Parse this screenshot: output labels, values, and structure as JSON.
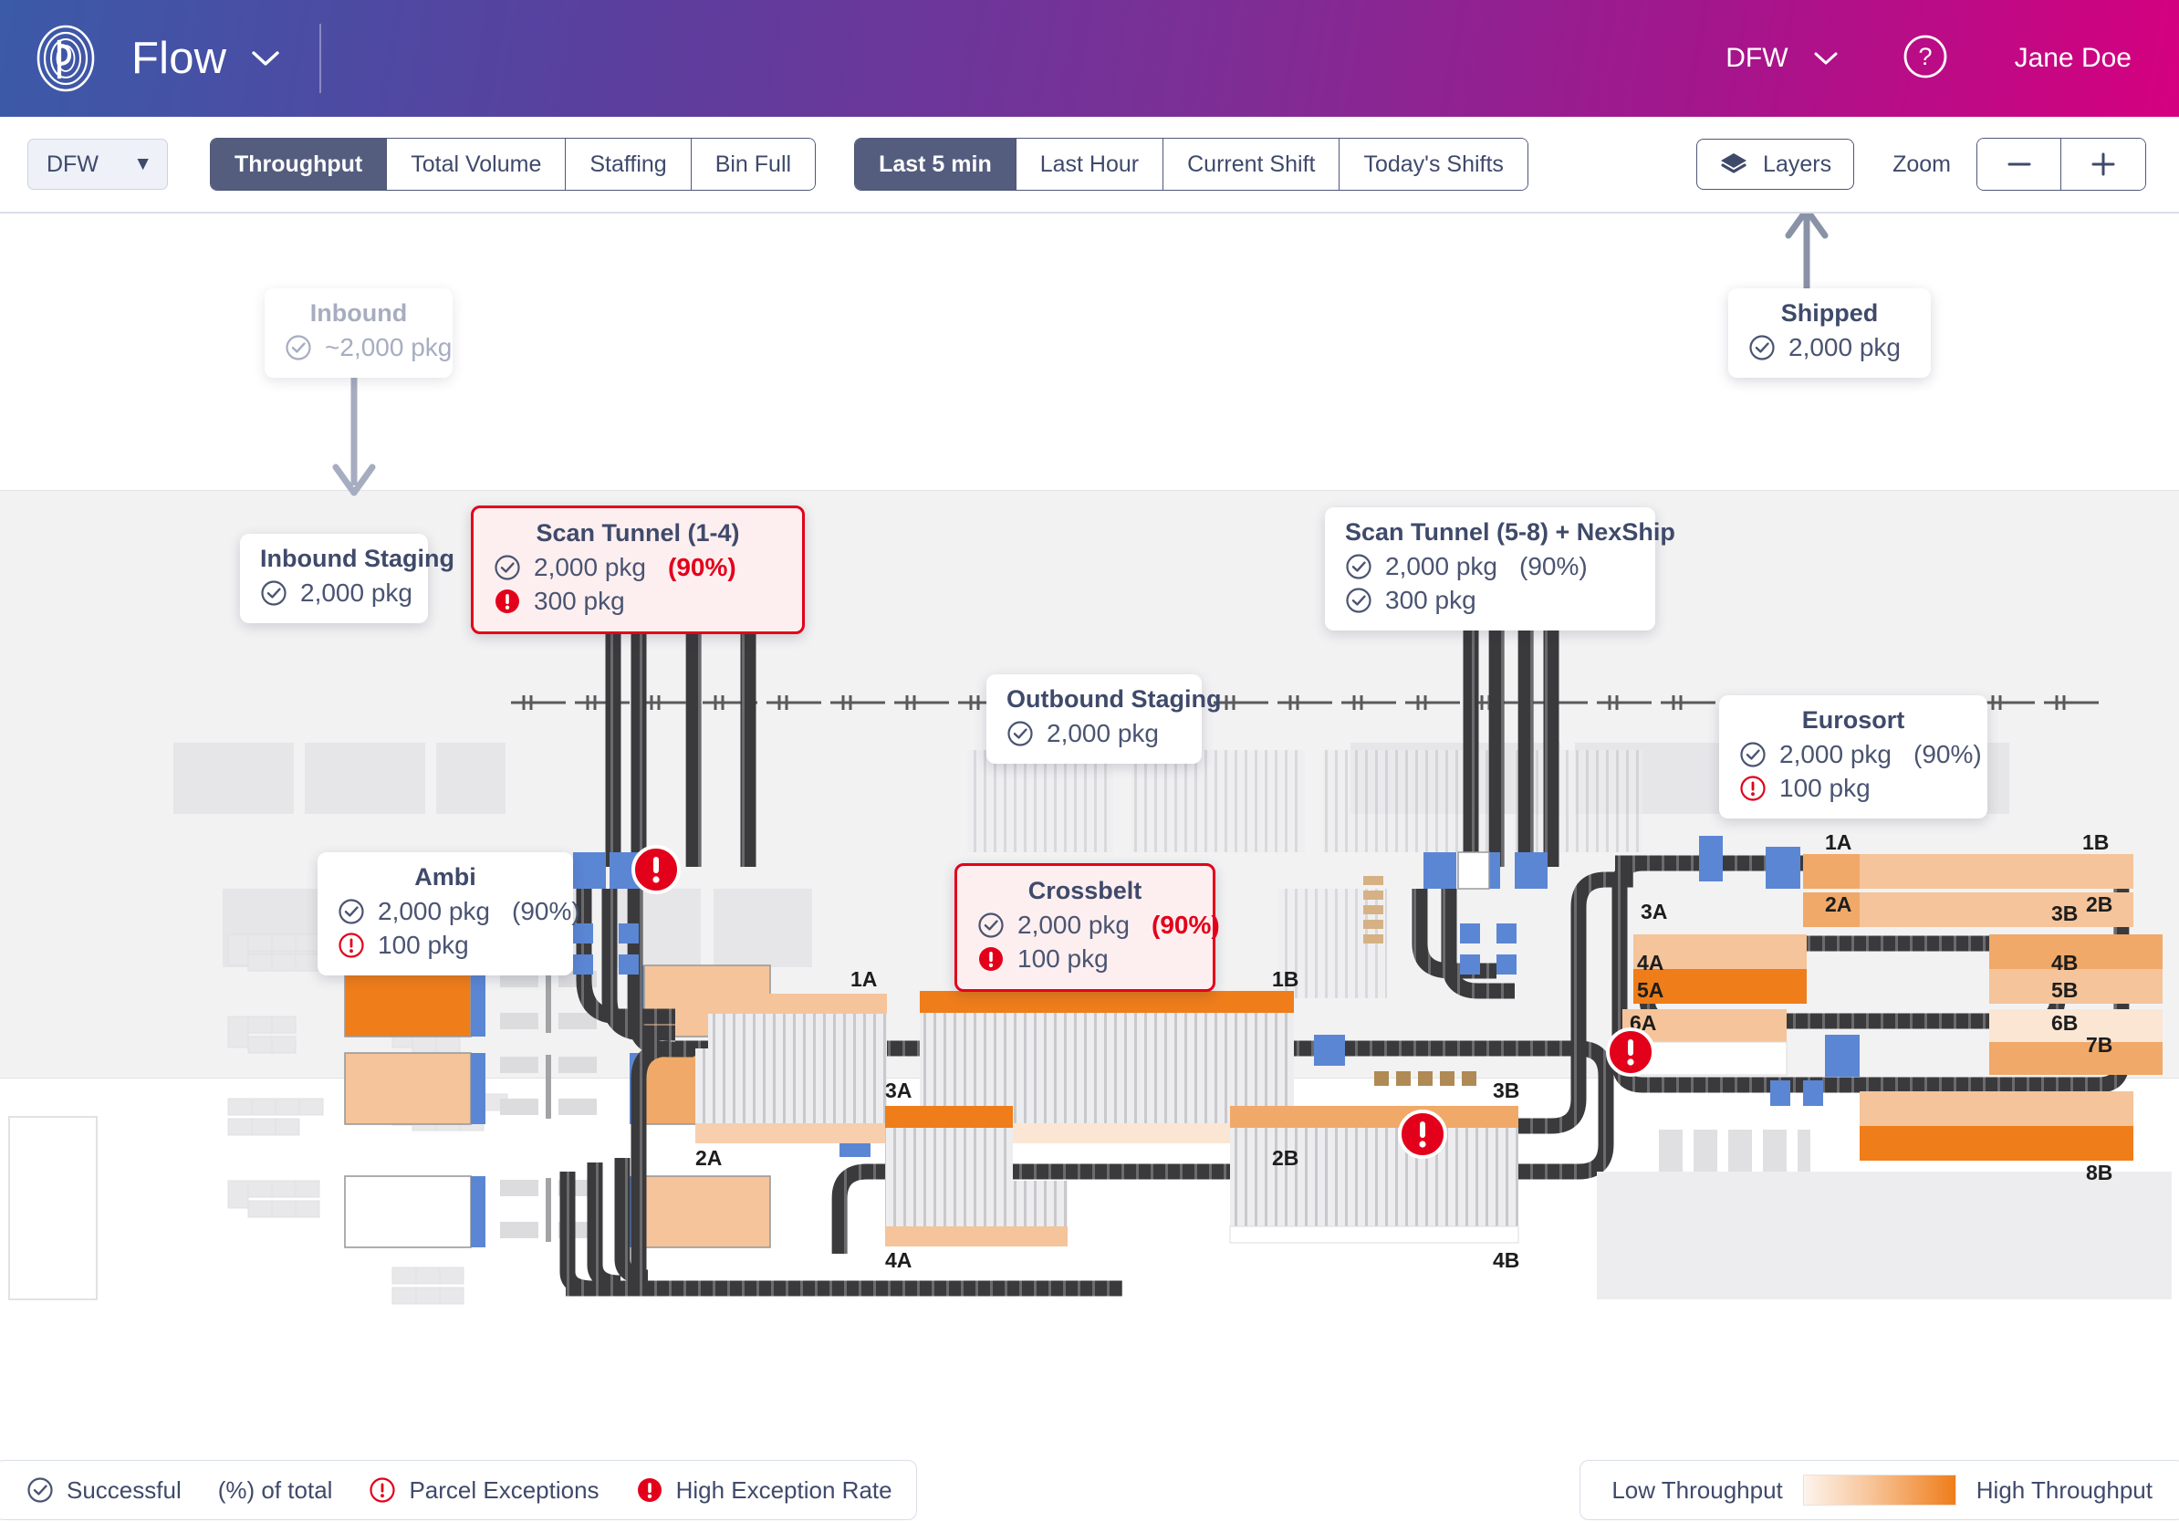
{
  "header": {
    "app_title": "Flow",
    "title_caret": "chevron-down-icon",
    "site": "DFW",
    "site_caret": "chevron-down-icon",
    "help": "help-circle-icon",
    "user": "Jane Doe"
  },
  "toolbar": {
    "site_select": {
      "value": "DFW",
      "caret": "▼"
    },
    "metric_tabs": [
      {
        "label": "Throughput",
        "active": true
      },
      {
        "label": "Total Volume",
        "active": false
      },
      {
        "label": "Staffing",
        "active": false
      },
      {
        "label": "Bin Full",
        "active": false
      }
    ],
    "time_tabs": [
      {
        "label": "Last 5 min",
        "active": true
      },
      {
        "label": "Last Hour",
        "active": false
      },
      {
        "label": "Current Shift",
        "active": false
      },
      {
        "label": "Today's Shifts",
        "active": false
      }
    ],
    "layers_label": "Layers",
    "zoom_label": "Zoom",
    "zoom_out": "−",
    "zoom_in": "+"
  },
  "nodes": {
    "inbound": {
      "title": "Inbound",
      "success": "~2,000 pkg",
      "state": "ghost"
    },
    "inbound_staging": {
      "title": "Inbound Staging",
      "success": "2,000 pkg",
      "state": "normal"
    },
    "scan_tunnel_14": {
      "title": "Scan Tunnel (1-4)",
      "success": "2,000 pkg",
      "pct": "(90%)",
      "exception": "300 pkg",
      "state": "alert"
    },
    "scan_tunnel_58": {
      "title": "Scan Tunnel (5-8) + NexShip",
      "success": "2,000 pkg",
      "pct": "(90%)",
      "second": "300 pkg",
      "state": "normal"
    },
    "ambi": {
      "title": "Ambi",
      "success": "2,000 pkg",
      "pct": "(90%)",
      "exception": "100 pkg",
      "state": "warn"
    },
    "outbound_staging": {
      "title": "Outbound Staging",
      "success": "2,000 pkg",
      "state": "normal"
    },
    "crossbelt": {
      "title": "Crossbelt",
      "success": "2,000 pkg",
      "pct": "(90%)",
      "exception": "100 pkg",
      "state": "alert"
    },
    "eurosort": {
      "title": "Eurosort",
      "success": "2,000 pkg",
      "pct": "(90%)",
      "exception": "100 pkg",
      "state": "warn"
    },
    "shipped": {
      "title": "Shipped",
      "success": "2,000 pkg",
      "state": "normal"
    }
  },
  "crossbelt_chutes": {
    "labels": [
      "1A",
      "2A",
      "3A",
      "4A",
      "1B",
      "2B",
      "3B",
      "4B"
    ]
  },
  "eurosort_chutes": {
    "labels_a": [
      "1A",
      "2A",
      "3A",
      "4A",
      "5A",
      "6A"
    ],
    "labels_b": [
      "1B",
      "2B",
      "3B",
      "4B",
      "5B",
      "6B",
      "7B",
      "8B"
    ]
  },
  "legend": {
    "items": [
      {
        "icon": "check-circle-icon",
        "label": "Successful"
      },
      {
        "icon": "none",
        "label": "(%) of total"
      },
      {
        "icon": "exclamation-outline-icon",
        "label": "Parcel Exceptions"
      },
      {
        "icon": "exclamation-filled-icon",
        "label": "High Exception Rate"
      }
    ],
    "scale_low": "Low Throughput",
    "scale_high": "High Throughput"
  },
  "colors": {
    "brand_start": "#3b5aa8",
    "brand_end": "#d5007f",
    "accent_navy": "#545d7e",
    "alert_red": "#e3001b",
    "throughput_high": "#ef7d1a",
    "throughput_low": "#fdf4ec",
    "conveyor": "#3a3a3c",
    "divert_blue": "#5b86d4"
  }
}
